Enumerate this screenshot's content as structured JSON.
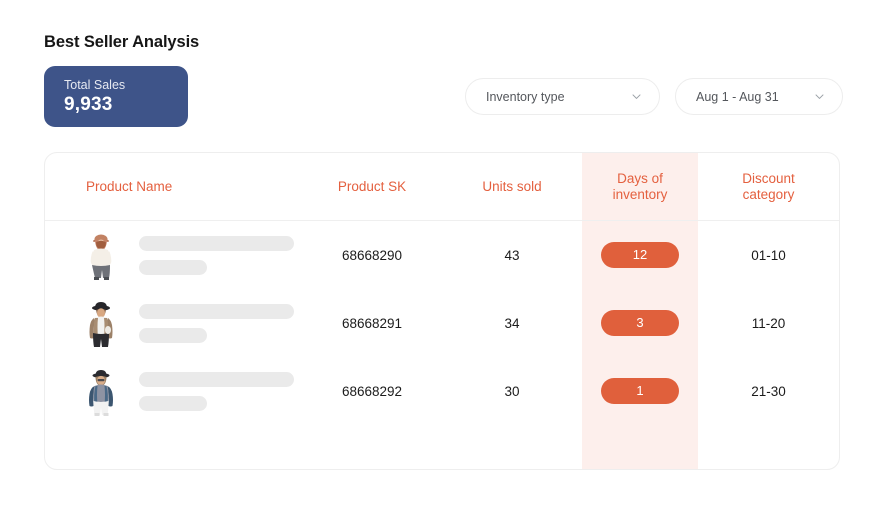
{
  "page": {
    "title": "Best Seller Analysis"
  },
  "kpi": {
    "label": "Total Sales",
    "value": "9,933",
    "color": "#3E5489"
  },
  "filters": {
    "inventory_type": {
      "label": "Inventory type",
      "icon": "chevron-down-icon"
    },
    "date_range": {
      "label": "Aug 1 - Aug 31",
      "icon": "chevron-down-icon"
    }
  },
  "table": {
    "header_color": "#E4603F",
    "highlight_color": "#FDEFEC",
    "badge_color": "#E0603C",
    "columns": [
      {
        "label": "Product Name",
        "key": "name"
      },
      {
        "label": "Product SK",
        "key": "sk"
      },
      {
        "label": "Units sold",
        "key": "units"
      },
      {
        "label": "Days of inventory",
        "line1": "Days of",
        "line2": "inventory",
        "key": "days",
        "highlighted": true
      },
      {
        "label": "Discount category",
        "line1": "Discount",
        "line2": "category",
        "key": "discount"
      }
    ],
    "rows": [
      {
        "thumbnail": "product-photo-woman-hat-cream-top",
        "sk": "68668290",
        "units": "43",
        "days": "12",
        "discount": "01-10"
      },
      {
        "thumbnail": "product-photo-woman-black-hat-tan-coat",
        "sk": "68668291",
        "units": "34",
        "days": "3",
        "discount": "11-20"
      },
      {
        "thumbnail": "product-photo-woman-denim-jacket",
        "sk": "68668292",
        "units": "30",
        "days": "1",
        "discount": "21-30"
      }
    ]
  }
}
